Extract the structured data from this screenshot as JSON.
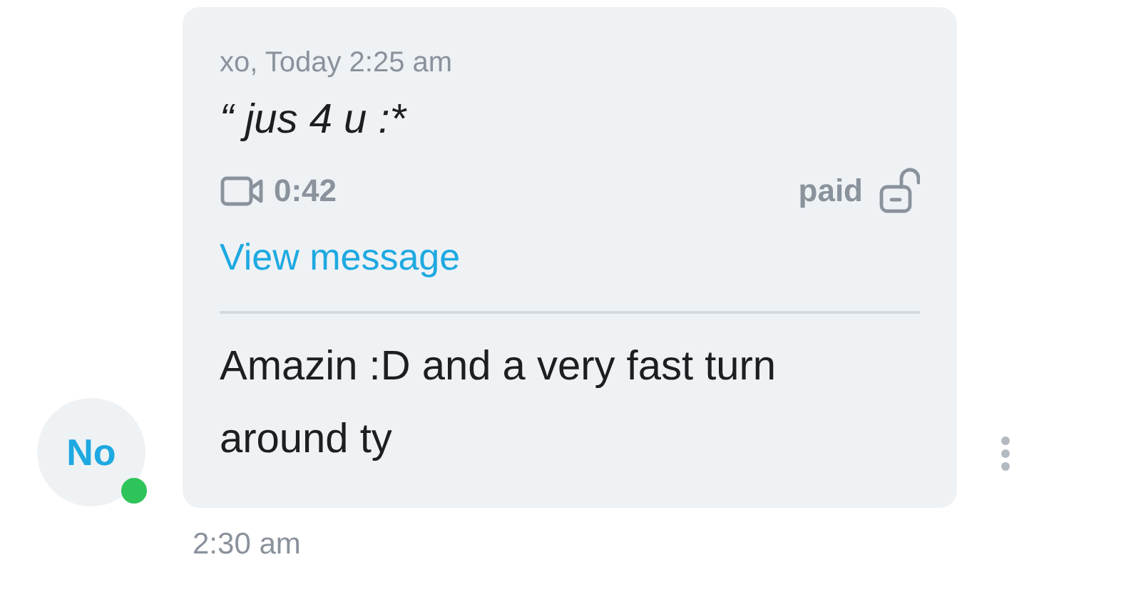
{
  "quoted_message": {
    "meta": "xo, Today 2:25 am",
    "quote_mark": "“",
    "text": "jus 4 u :*",
    "duration": "0:42",
    "price_label": "paid",
    "link": "View message"
  },
  "reply": {
    "text": "Amazin :D and a very fast turn around ty",
    "time": "2:30 am"
  },
  "sender": {
    "initials": "No",
    "online": true
  }
}
